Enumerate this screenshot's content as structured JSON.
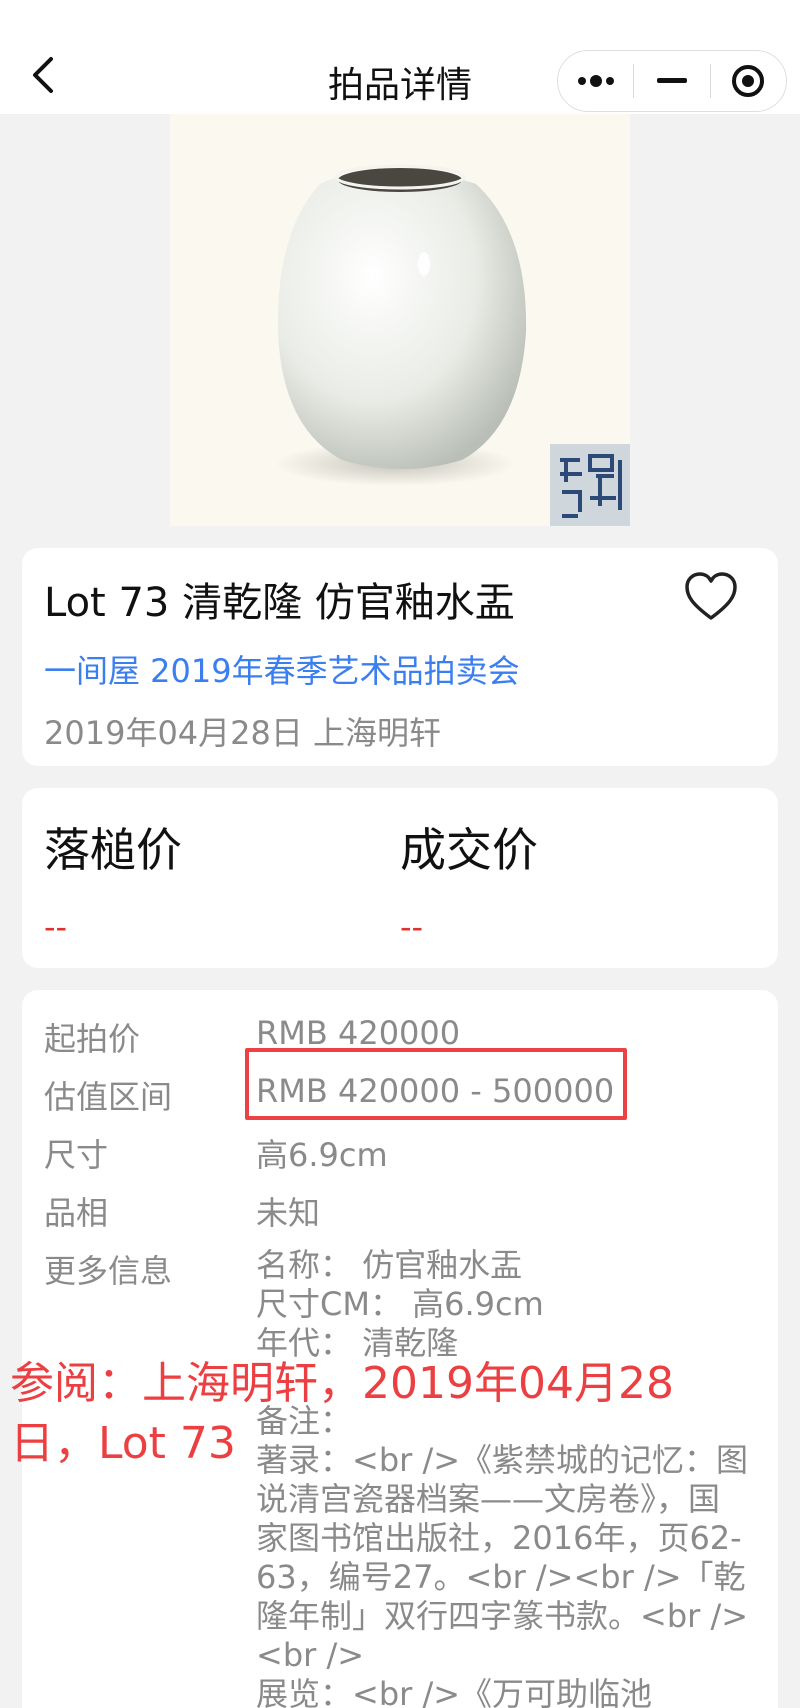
{
  "header": {
    "title": "拍品详情",
    "back_icon": "chevron-left-icon",
    "capsule_icons": [
      "more-dots-icon",
      "minimize-icon",
      "record-target-icon"
    ]
  },
  "lot": {
    "title": "Lot 73 清乾隆 仿官釉水盂",
    "auction": "一间屋 2019年春季艺术品拍卖会",
    "date_location": "2019年04月28日 上海明轩",
    "favorite_icon": "heart-outline-icon"
  },
  "prices": {
    "hammer_label": "落槌价",
    "hammer_value": "--",
    "deal_label": "成交价",
    "deal_value": "--"
  },
  "info": {
    "start_label": "起拍价",
    "start_value": "RMB 420000",
    "estimate_label": "估值区间",
    "estimate_value": "RMB 420000 - 500000",
    "size_label": "尺寸",
    "size_value": "高6.9cm",
    "condition_label": "品相",
    "condition_value": "未知",
    "more_label": "更多信息",
    "more_lines": [
      "名称： 仿官釉水盂",
      "尺寸CM： 高6.9cm",
      "年代： 清乾隆",
      "",
      "备注：",
      "著录：<br />《紫禁城的记忆：图",
      "说清宫瓷器档案——文房卷》，国",
      "家图书馆出版社，2016年，页62-",
      "63，编号27。<br /><br />「乾",
      "隆年制」双行四字篆书款。<br />",
      "<br />",
      "展览：<br />《万可助临池"
    ]
  },
  "overlay": {
    "line1": "参阅：上海明轩，2019年04月28",
    "line2": "日，Lot 73"
  },
  "colors": {
    "accent_blue": "#3b7ef0",
    "price_red": "#e0322c",
    "annotation_red": "#ec3f42"
  }
}
